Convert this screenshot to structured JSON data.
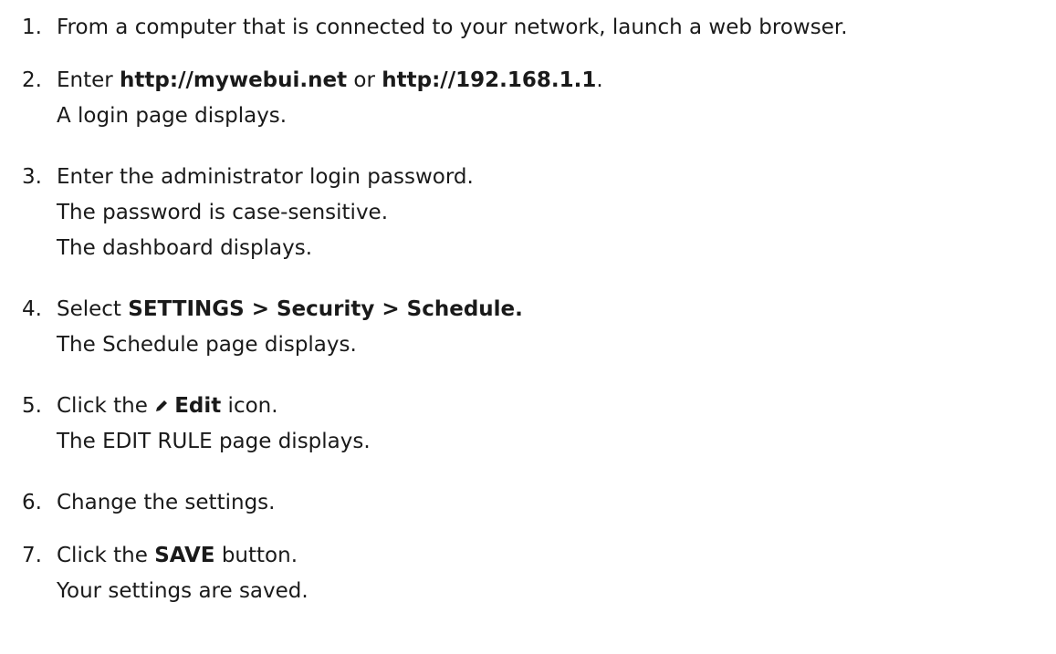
{
  "steps": [
    {
      "num": "1.",
      "text": "From a computer that is connected to your network, launch a web browser."
    },
    {
      "num": "2.",
      "pre": "Enter ",
      "url1": "http://mywebui.net",
      "mid": " or ",
      "url2": "http://192.168.1.1",
      "post": ".",
      "sub": [
        "A login page displays."
      ]
    },
    {
      "num": "3.",
      "text": "Enter the administrator login password.",
      "sub": [
        "The password is case-sensitive.",
        "The dashboard displays."
      ]
    },
    {
      "num": "4.",
      "pre": "Select ",
      "bold": "SETTINGS > Security > Schedule.",
      "sub": [
        "The Schedule page displays."
      ]
    },
    {
      "num": "5.",
      "pre": "Click the ",
      "icon": "pencil-icon",
      "bold": "Edit",
      "post": " icon.",
      "sub": [
        "The EDIT RULE page displays."
      ]
    },
    {
      "num": "6.",
      "text": "Change the settings."
    },
    {
      "num": "7.",
      "pre": "Click the ",
      "bold": "SAVE",
      "post": " button.",
      "sub": [
        "Your settings are saved."
      ]
    }
  ]
}
